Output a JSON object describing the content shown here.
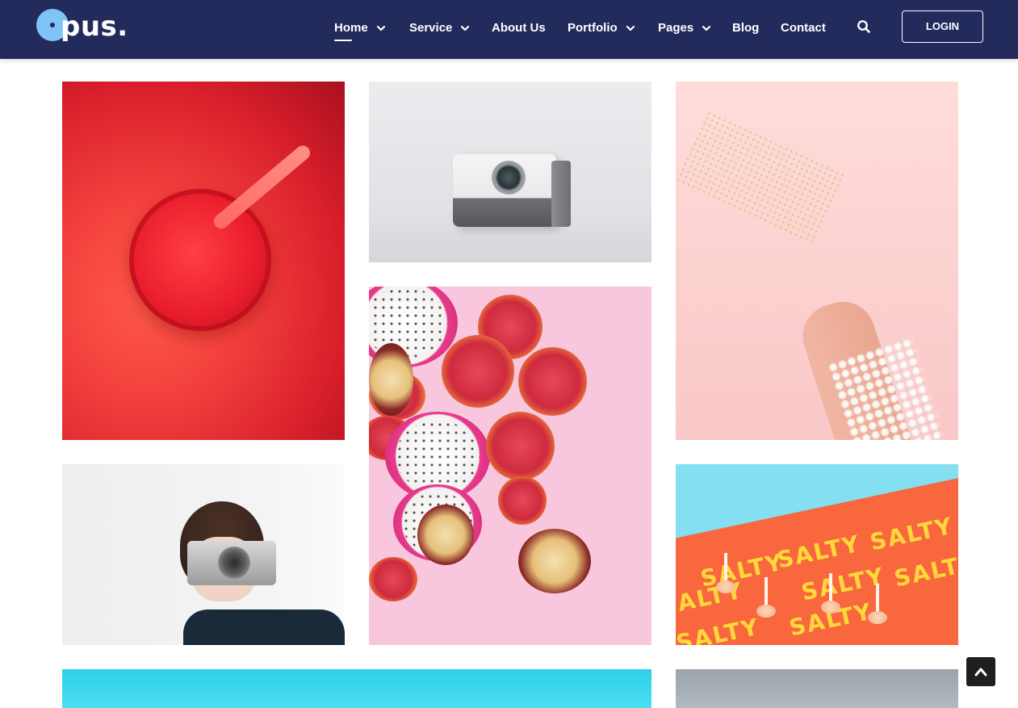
{
  "brand": {
    "logo_text": "pus.",
    "logo_mark": "circle-logo-mark"
  },
  "nav": {
    "items": [
      {
        "label": "Home",
        "has_dropdown": true,
        "active": true
      },
      {
        "label": "Service",
        "has_dropdown": true,
        "active": false
      },
      {
        "label": "About Us",
        "has_dropdown": false,
        "active": false
      },
      {
        "label": "Portfolio",
        "has_dropdown": true,
        "active": false
      },
      {
        "label": "Pages",
        "has_dropdown": true,
        "active": false
      },
      {
        "label": "Blog",
        "has_dropdown": false,
        "active": false
      },
      {
        "label": "Contact",
        "has_dropdown": false,
        "active": false
      }
    ],
    "search_icon": "search-icon",
    "login_label": "LOGIN"
  },
  "gallery": {
    "tiles": [
      {
        "subject": "red-drink-with-straw"
      },
      {
        "subject": "instant-camera"
      },
      {
        "subject": "hand-holding-glitter-glass"
      },
      {
        "subject": "dragon-fruit-and-blood-orange"
      },
      {
        "subject": "woman-with-film-camera"
      },
      {
        "subject": "salty-letters-popsicles",
        "text": "SALTY"
      },
      {
        "subject": "cyan-backdrop"
      },
      {
        "subject": "grey-backdrop"
      }
    ]
  },
  "back_to_top": {
    "icon": "chevron-up-icon"
  },
  "colors": {
    "header_bg": "#232a5c",
    "accent_logo": "#7fc3f7",
    "back_to_top_bg": "#1f1f1f"
  }
}
